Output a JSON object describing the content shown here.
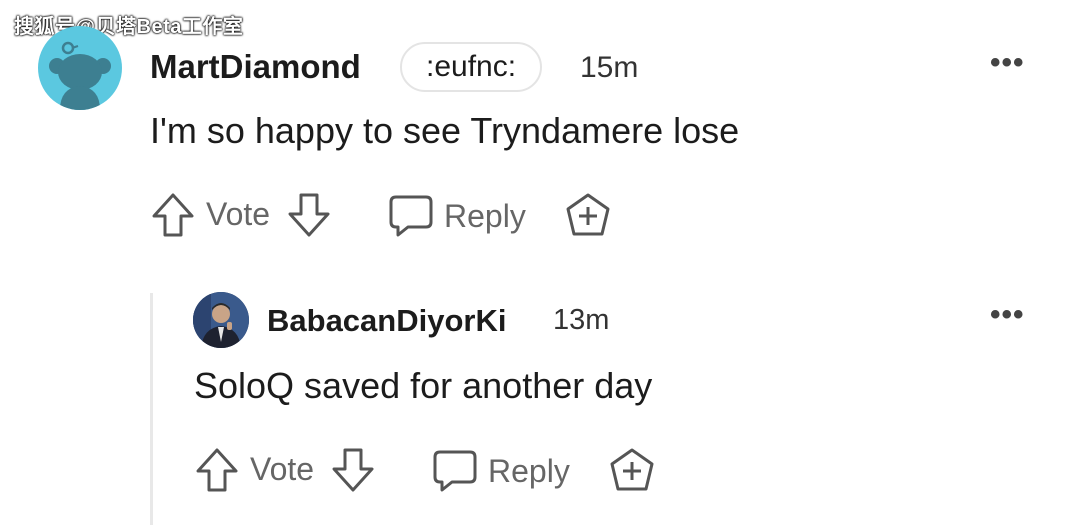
{
  "watermark": "搜狐号@贝塔Beta工作室",
  "comments": [
    {
      "username": "MartDiamond",
      "flair": ":eufnc:",
      "time": "15m",
      "body": "I'm so happy to see Tryndamere lose",
      "vote_label": "Vote",
      "reply_label": "Reply"
    },
    {
      "username": "BabacanDiyorKi",
      "time": "13m",
      "body": "SoloQ saved for another day",
      "vote_label": "Vote",
      "reply_label": "Reply"
    }
  ],
  "icons": {
    "upvote": "arrow-up-outline-icon",
    "downvote": "arrow-down-outline-icon",
    "reply": "speech-bubble-icon",
    "award": "award-plus-icon",
    "more": "more-options-icon"
  },
  "colors": {
    "avatar_bg": "#5bc8e0",
    "text": "#1c1c1c",
    "muted": "#666666",
    "thread_line": "#e8e8e8"
  }
}
